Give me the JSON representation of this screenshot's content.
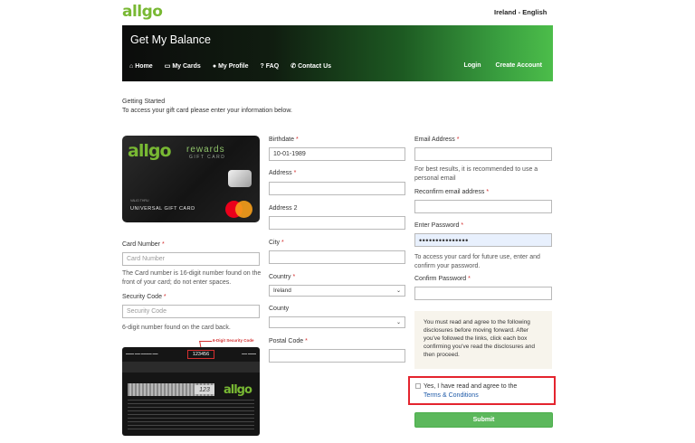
{
  "header": {
    "logo": "allgo",
    "language": "Ireland - English"
  },
  "banner": {
    "title": "Get My Balance",
    "nav": [
      {
        "icon": "home-icon",
        "label": "Home"
      },
      {
        "icon": "card-icon",
        "label": "My Cards"
      },
      {
        "icon": "user-icon",
        "label": "My Profile"
      },
      {
        "icon": "question-icon",
        "label": "FAQ"
      },
      {
        "icon": "phone-icon",
        "label": "Contact Us"
      }
    ],
    "login": "Login",
    "create_account": "Create Account"
  },
  "intro": {
    "heading": "Getting Started",
    "text": "To access your gift card please enter your information below."
  },
  "card_front": {
    "logo": "allgo",
    "rewards": "rewards",
    "gift_card": "GIFT CARD",
    "valid_thru": "VALID THRU",
    "name": "UNIVERSAL GIFT CARD"
  },
  "card_back": {
    "security_code_sample": "123456",
    "cvv_sample": "123",
    "logo": "allgo",
    "arrow_note": "6-Digit Security Code"
  },
  "form": {
    "card_number": {
      "label": "Card Number",
      "placeholder": "Card Number",
      "help": "The Card number is 16-digit number found on the front of your card; do not enter spaces."
    },
    "security_code": {
      "label": "Security Code",
      "placeholder": "Security Code",
      "help": "6-digit number found on the card back."
    },
    "birthdate": {
      "label": "Birthdate",
      "value": "10-01-1989"
    },
    "address": {
      "label": "Address",
      "value": ""
    },
    "address2": {
      "label": "Address 2",
      "value": ""
    },
    "city": {
      "label": "City",
      "value": ""
    },
    "country": {
      "label": "Country",
      "value": "Ireland"
    },
    "county": {
      "label": "County",
      "value": ""
    },
    "postal_code": {
      "label": "Postal Code",
      "value": ""
    },
    "email": {
      "label": "Email Address",
      "value": "",
      "help": "For best results, it is recommended to use a personal email"
    },
    "reconfirm_email": {
      "label": "Reconfirm email address",
      "value": ""
    },
    "password": {
      "label": "Enter Password",
      "value": "•••••••••••••••",
      "help": "To access your card for future use, enter and confirm your password."
    },
    "confirm_password": {
      "label": "Confirm Password",
      "value": ""
    },
    "required_mark": "*"
  },
  "disclosure": {
    "text": "You must read and agree to the following disclosures before moving forward. After you've followed the links, click each box confirming you've read the disclosures and then proceed."
  },
  "agree": {
    "text": "Yes, I have read and agree to the",
    "link": "Terms & Conditions"
  },
  "submit_label": "Submit",
  "colors": {
    "brand_green": "#78b833",
    "submit_green": "#5cb85c",
    "required_red": "#d32f2f",
    "highlight_red": "#e4242e",
    "link_blue": "#1e5aa8"
  }
}
